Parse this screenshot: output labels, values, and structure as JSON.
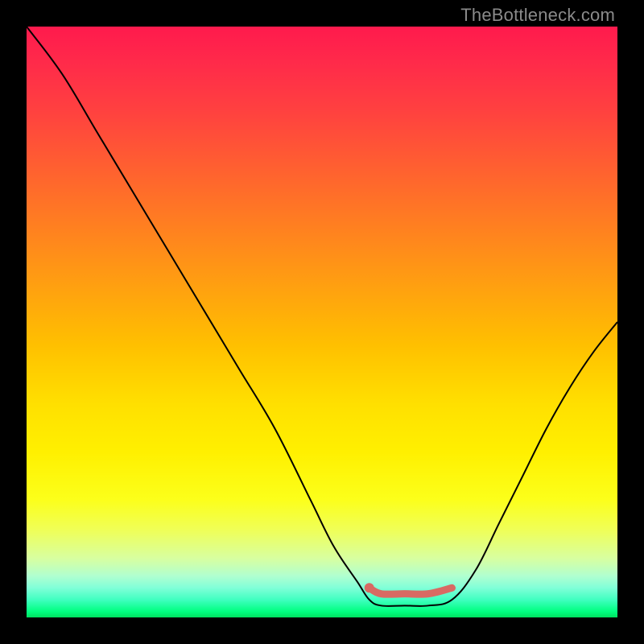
{
  "watermark": "TheBottleneck.com",
  "chart_data": {
    "type": "line",
    "title": "",
    "xlabel": "",
    "ylabel": "",
    "xlim": [
      0,
      100
    ],
    "ylim": [
      0,
      100
    ],
    "grid": false,
    "series": [
      {
        "name": "bottleneck-curve",
        "x": [
          0,
          6,
          12,
          18,
          24,
          30,
          36,
          42,
          48,
          52,
          56,
          58,
          60,
          64,
          68,
          72,
          76,
          80,
          84,
          88,
          92,
          96,
          100
        ],
        "y": [
          100,
          92,
          82,
          72,
          62,
          52,
          42,
          32,
          20,
          12,
          6,
          3,
          2,
          2,
          2,
          3,
          8,
          16,
          24,
          32,
          39,
          45,
          50
        ]
      }
    ],
    "highlight": {
      "name": "optimal-range",
      "x": [
        58,
        60,
        64,
        68,
        72
      ],
      "y": [
        5,
        4,
        4,
        4,
        5
      ]
    },
    "background_gradient": {
      "top": "#ff1a4d",
      "mid": "#ffe000",
      "bottom": "#00e060"
    }
  }
}
